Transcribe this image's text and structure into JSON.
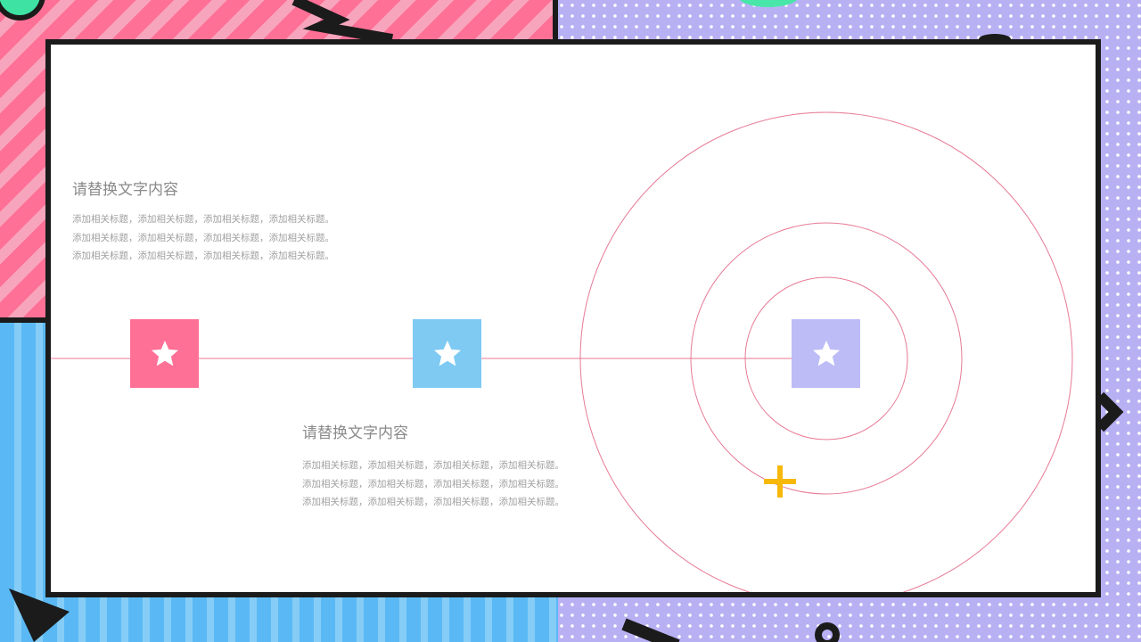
{
  "background": {
    "dot_color": "#b7b1f4",
    "pink_stripe": "#ff7096",
    "blue_stripe": "#5ab9f5"
  },
  "content": {
    "block_top": {
      "heading": "请替换文字内容",
      "lines": [
        "添加相关标题，添加相关标题，添加相关标题，添加相关标题。",
        "添加相关标题，添加相关标题，添加相关标题，添加相关标题。",
        "添加相关标题，添加相关标题，添加相关标题，添加相关标题。"
      ]
    },
    "block_bottom": {
      "heading": "请替换文字内容",
      "lines": [
        "添加相关标题，添加相关标题，添加相关标题，添加相关标题。",
        "添加相关标题，添加相关标题，添加相关标题，添加相关标题。",
        "添加相关标题，添加相关标题，添加相关标题，添加相关标题。"
      ]
    }
  },
  "timeline": {
    "line_color": "#e77a95",
    "markers": [
      {
        "icon": "star-icon",
        "color": "#ff7096"
      },
      {
        "icon": "star-icon",
        "color": "#7fcaf3"
      },
      {
        "icon": "star-icon",
        "color": "#bdbcf7"
      }
    ]
  },
  "accent_plus_color": "#f7b80c"
}
